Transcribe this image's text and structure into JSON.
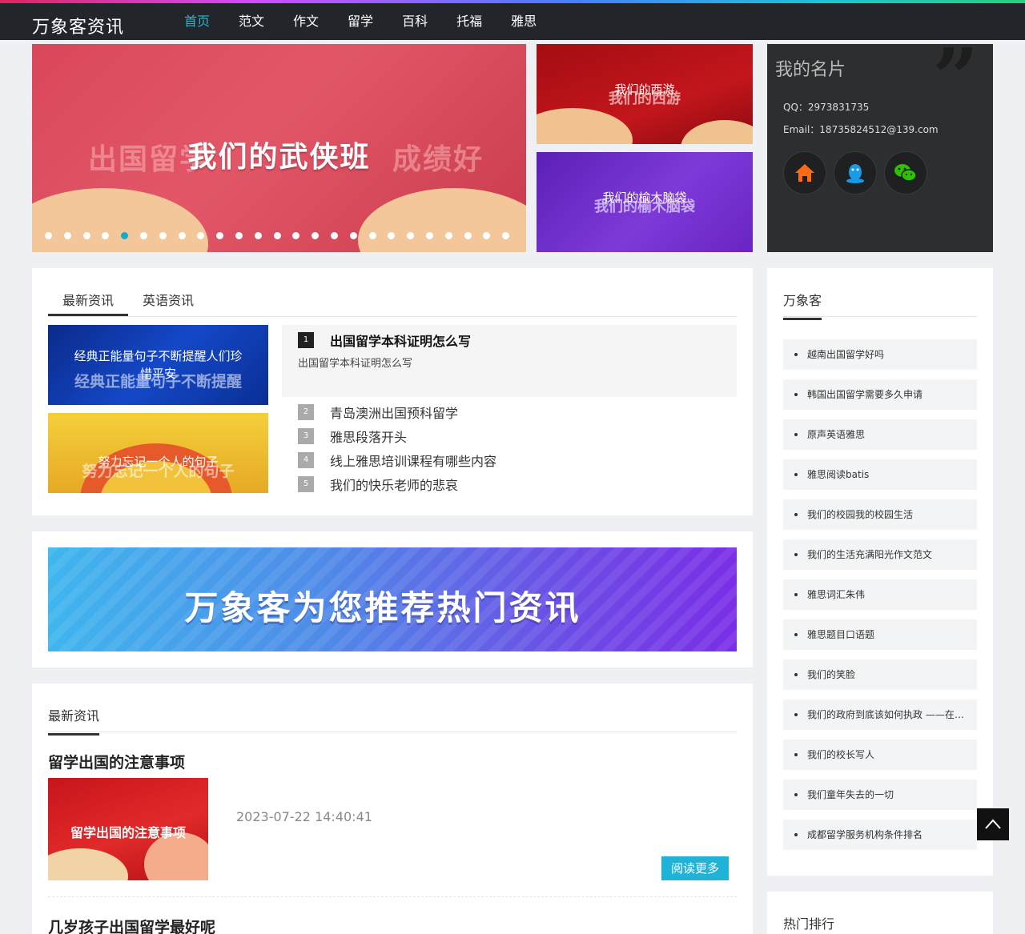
{
  "site": {
    "logo": "万象客资讯"
  },
  "nav": [
    {
      "label": "首页",
      "active": true
    },
    {
      "label": "范文"
    },
    {
      "label": "作文"
    },
    {
      "label": "留学"
    },
    {
      "label": "百科"
    },
    {
      "label": "托福"
    },
    {
      "label": "雅思"
    }
  ],
  "carousel": {
    "title": "我们的武侠班",
    "ghost_text": "出国留学　　　　　　成绩好",
    "dot_count": 25,
    "active_dot": 5
  },
  "side_banners": [
    {
      "title": "我们的西游",
      "ghost": "我们的西游"
    },
    {
      "title": "我们的榆木脑袋",
      "ghost": "我们的榆木脑袋"
    }
  ],
  "card": {
    "title": "我的名片",
    "qq": "QQ：2973831735",
    "email": "Email：18735824512@139.com",
    "icons": [
      "home-icon",
      "qq-icon",
      "wechat-icon"
    ]
  },
  "news_panel": {
    "tabs": [
      "最新资讯",
      "英语资讯"
    ],
    "thumbs": [
      {
        "title": "经典正能量句子不断提醒人们珍惜平安",
        "ghost": "经典正能量句子不断提醒"
      },
      {
        "title": "努力忘记一个人的句子",
        "ghost": "努力忘记一个人的句子"
      }
    ],
    "featured": {
      "num": "1",
      "title": "出国留学本科证明怎么写",
      "summary": "出国留学本科证明怎么写"
    },
    "ranks": [
      {
        "num": "2",
        "title": "青岛澳洲出国预科留学"
      },
      {
        "num": "3",
        "title": "雅思段落开头"
      },
      {
        "num": "4",
        "title": "线上雅思培训课程有哪些内容"
      },
      {
        "num": "5",
        "title": "我们的快乐老师的悲哀"
      }
    ]
  },
  "promo": {
    "text": "万象客为您推荐热门资讯"
  },
  "latest": {
    "title": "最新资讯",
    "articles": [
      {
        "title": "留学出国的注意事项",
        "image_text": "留学出国的注意事项",
        "date": "2023-07-22 14:40:41",
        "read_more": "阅读更多"
      },
      {
        "title": "几岁孩子出国留学最好呢"
      }
    ]
  },
  "sidebar": {
    "title": "万象客",
    "items": [
      "越南出国留学好吗",
      "韩国出国留学需要多久申请",
      "原声英语雅思",
      "雅思阅读batis",
      "我们的校园我的校园生活",
      "我们的生活充满阳光作文范文",
      "雅思词汇朱伟",
      "雅思题目口语题",
      "我们的笑脸",
      "我们的政府到底该如何执政 ——在…",
      "我们的校长写人",
      "我们童年失去的一切",
      "成都留学服务机构条件排名"
    ]
  },
  "hot": {
    "title": "热门排行"
  }
}
